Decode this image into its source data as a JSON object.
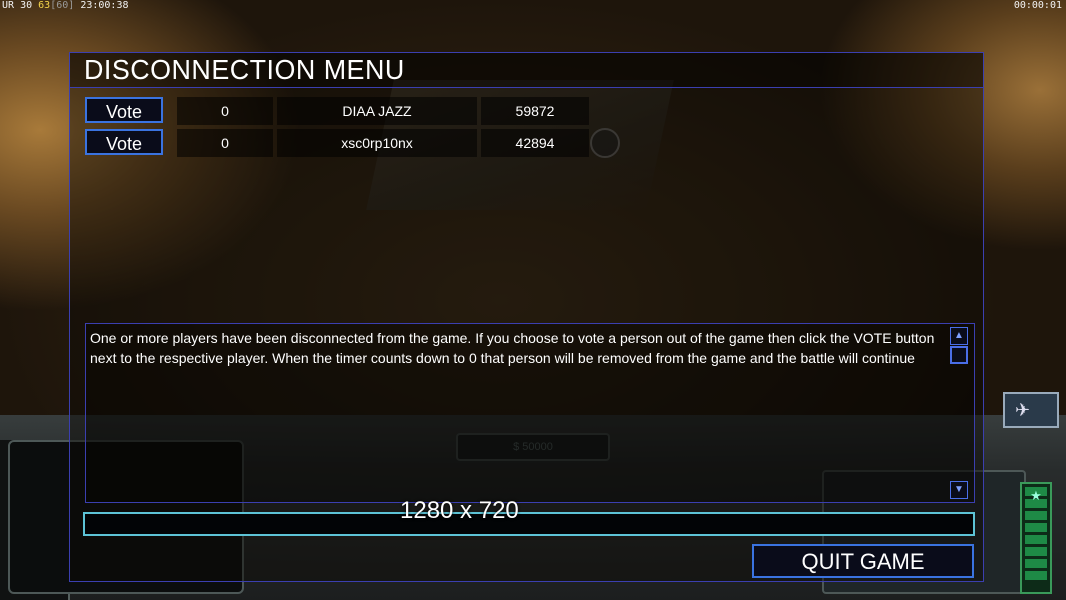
{
  "hud": {
    "left_prefix": "UR",
    "left_fps": "30",
    "left_rate": "63",
    "left_bracket": "[60]",
    "left_time": "23:00:38",
    "right_time": "00:00:01"
  },
  "money": "$ 50000",
  "dialog": {
    "title": "DISCONNECTION MENU",
    "players": [
      {
        "vote_label": "Vote",
        "count": "0",
        "name": "DIAA JAZZ",
        "ping": "59872"
      },
      {
        "vote_label": "Vote",
        "count": "0",
        "name": "xsc0rp10nx",
        "ping": "42894"
      }
    ],
    "message": "One or more players have been disconnected from the game. If you choose to vote a person out of the game then click the VOTE button next to the respective player. When the timer counts down to 0 that person will be removed from the game and the battle will continue",
    "chat_value": "",
    "quit_label": "QUIT GAME"
  },
  "overlay_resolution": "1280 x 720",
  "colors": {
    "dialog_border": "#3b3fb0",
    "button_border": "#3a73e0",
    "chat_border": "#5dc3d6",
    "hud_yellow": "#f3d34a"
  },
  "icons": {
    "scroll_up": "triangle-up-icon",
    "scroll_down": "triangle-down-icon",
    "portrait": "satellite-icon"
  }
}
